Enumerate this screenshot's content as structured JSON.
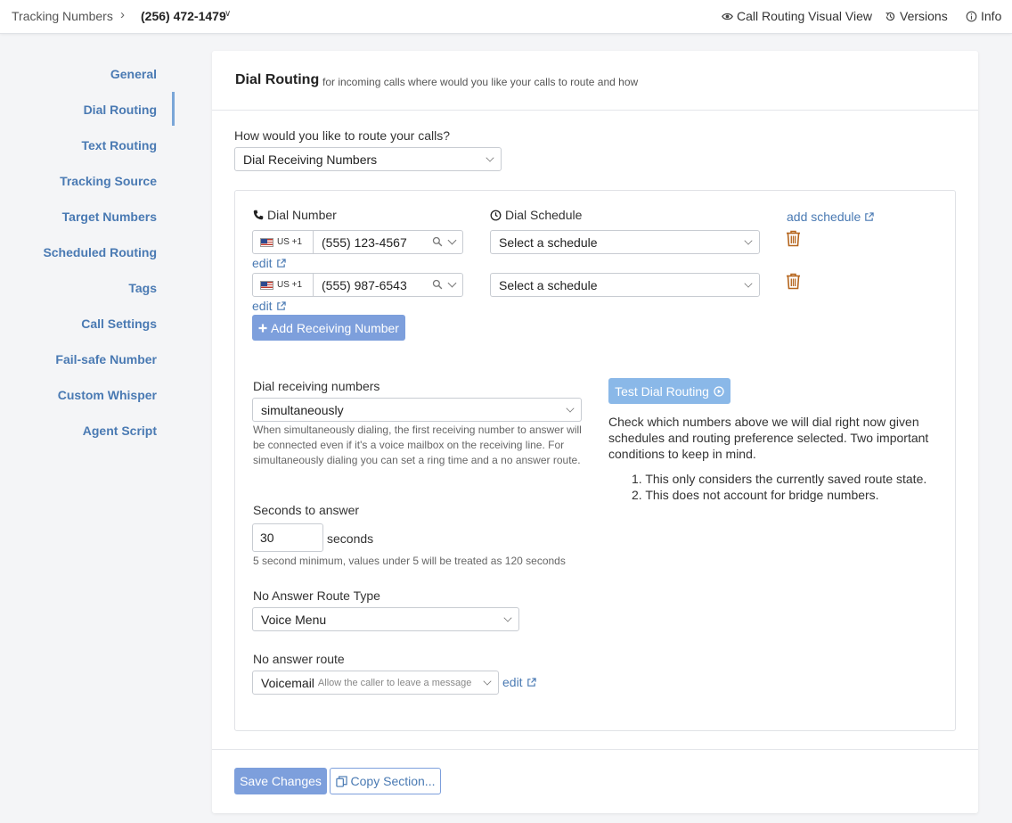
{
  "topbar": {
    "breadcrumb_root": "Tracking Numbers",
    "breadcrumb_current": "(256) 472-1479",
    "visual_view": "Call Routing Visual View",
    "versions": "Versions",
    "info": "Info"
  },
  "sidebar": {
    "items": [
      {
        "label": "General"
      },
      {
        "label": "Dial Routing",
        "active": true
      },
      {
        "label": "Text Routing"
      },
      {
        "label": "Tracking Source"
      },
      {
        "label": "Target Numbers"
      },
      {
        "label": "Scheduled Routing"
      },
      {
        "label": "Tags"
      },
      {
        "label": "Call Settings"
      },
      {
        "label": "Fail-safe Number"
      },
      {
        "label": "Custom Whisper"
      },
      {
        "label": "Agent Script"
      }
    ]
  },
  "card": {
    "title": "Dial Routing",
    "subtitle": "for incoming calls where would you like your calls to route and how",
    "route_question": "How would you like to route your calls?",
    "route_value": "Dial Receiving Numbers"
  },
  "dial": {
    "number_header": "Dial Number",
    "schedule_header": "Dial Schedule",
    "add_schedule": "add schedule",
    "rows": [
      {
        "country": "US +1",
        "number": "(555) 123-4567",
        "schedule": "Select a schedule",
        "edit": "edit"
      },
      {
        "country": "US +1",
        "number": "(555) 987-6543",
        "schedule": "Select a schedule",
        "edit": "edit"
      }
    ],
    "add_button": "Add Receiving Number"
  },
  "options": {
    "dial_mode_label": "Dial receiving numbers",
    "dial_mode_value": "simultaneously",
    "dial_mode_help": "When simultaneously dialing, the first receiving number to answer will be connected even if it's a voice mailbox on the receiving line. For simultaneously dialing you can set a ring time and a no answer route.",
    "seconds_label": "Seconds to answer",
    "seconds_value": "30",
    "seconds_unit": "seconds",
    "seconds_help": "5 second minimum, values under 5 will be treated as 120 seconds",
    "no_answer_type_label": "No Answer Route Type",
    "no_answer_type_value": "Voice Menu",
    "no_answer_route_label": "No answer route",
    "no_answer_route_value": "Voicemail",
    "no_answer_route_hint": "Allow the caller to leave a message",
    "no_answer_route_edit": "edit"
  },
  "test": {
    "button": "Test Dial Routing",
    "description": "Check which numbers above we will dial right now given schedules and routing preference selected. Two important conditions to keep in mind.",
    "conditions": [
      "This only considers the currently saved route state.",
      "This does not account for bridge numbers."
    ]
  },
  "footer": {
    "save": "Save Changes",
    "copy": "Copy Section..."
  },
  "colors": {
    "accent": "#7d9fdc",
    "link": "#4a7ab3",
    "trash": "#b5651d"
  }
}
